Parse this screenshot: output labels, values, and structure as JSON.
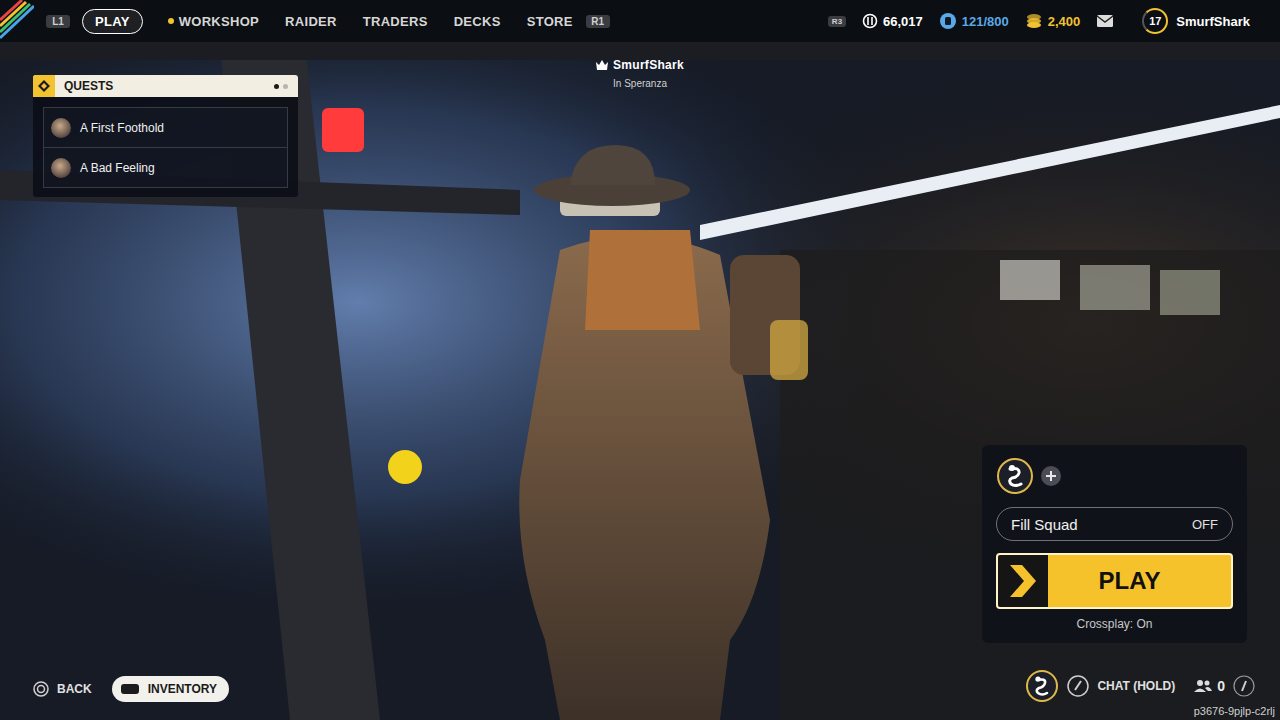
{
  "topbar": {
    "left_key": "L1",
    "right_key": "R1",
    "shoulder_key": "R3",
    "tabs": [
      {
        "label": "PLAY",
        "selected": true,
        "notify": false
      },
      {
        "label": "WORKSHOP",
        "selected": false,
        "notify": true
      },
      {
        "label": "RAIDER",
        "selected": false,
        "notify": false
      },
      {
        "label": "TRADERS",
        "selected": false,
        "notify": false
      },
      {
        "label": "DECKS",
        "selected": false,
        "notify": false
      },
      {
        "label": "STORE",
        "selected": false,
        "notify": false
      }
    ],
    "currencies": [
      {
        "kind": "coin",
        "value": "66,017",
        "color": "#ffffff"
      },
      {
        "kind": "token",
        "value": "121/800",
        "color": "#5aa9e6"
      },
      {
        "kind": "credit",
        "value": "2,400",
        "color": "#f2c230"
      }
    ],
    "level": "17",
    "username": "SmurfShark"
  },
  "quests": {
    "title": "QUESTS",
    "pages": [
      {
        "selected": true
      },
      {
        "selected": false
      }
    ],
    "items": [
      {
        "label": "A First Foothold"
      },
      {
        "label": "A Bad Feeling"
      }
    ]
  },
  "player": {
    "name": "SmurfShark",
    "location": "In Speranza"
  },
  "squad": {
    "fill_squad": {
      "label": "Fill Squad",
      "value": "OFF"
    },
    "play_button": "PLAY",
    "crossplay": "Crossplay: On"
  },
  "bottom": {
    "back": "BACK",
    "inventory": "INVENTORY",
    "chat": "CHAT (HOLD)",
    "friends": "0",
    "session_id": "p3676-9pjlp-c2rlj"
  }
}
